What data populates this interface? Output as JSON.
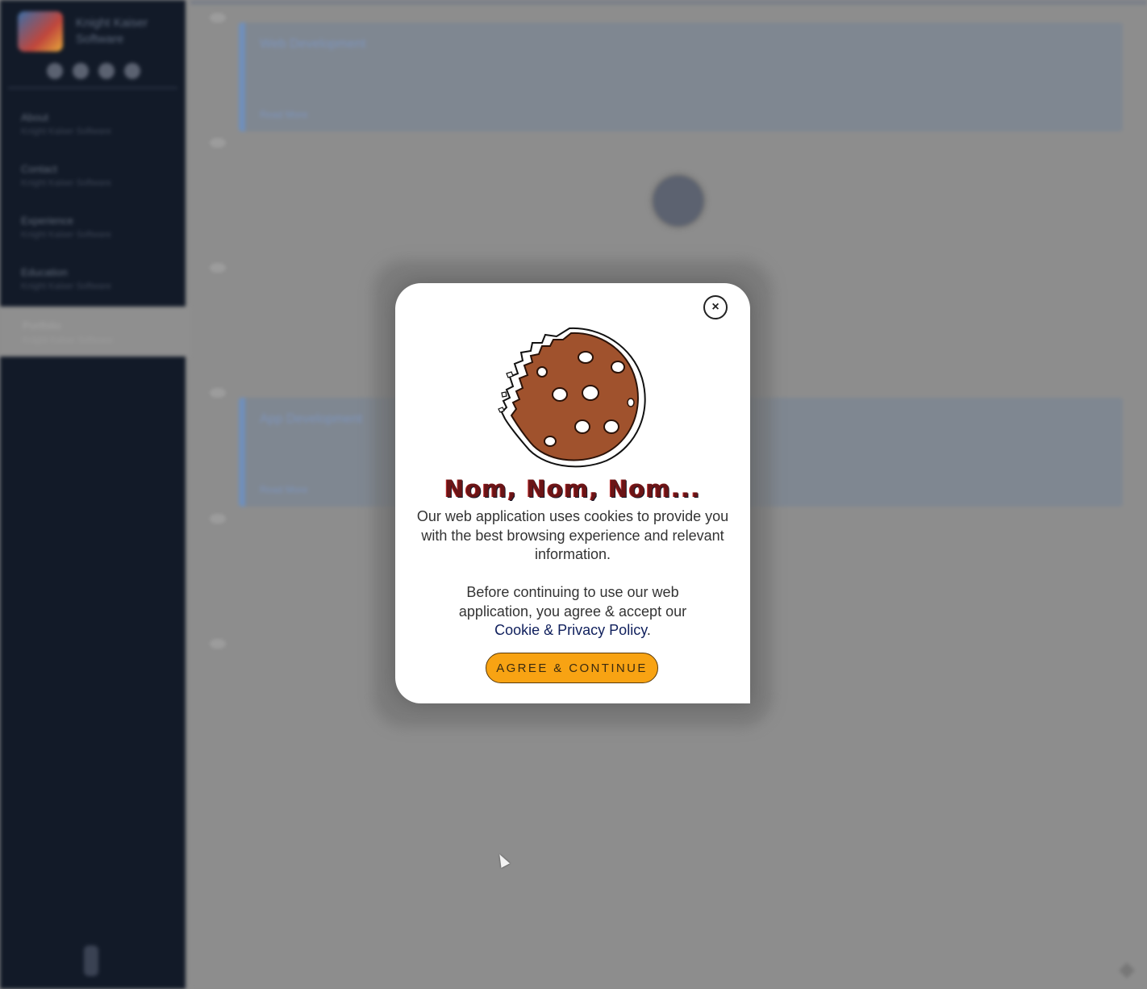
{
  "app": {
    "brand_name": "Knight Kaiser Software",
    "social_icons": [
      "social-icon-1",
      "social-icon-2",
      "social-icon-3",
      "social-icon-4"
    ],
    "nav_items": [
      {
        "title": "About",
        "subtitle": "Knight Kaiser Software"
      },
      {
        "title": "Contact",
        "subtitle": "Knight Kaiser Software"
      },
      {
        "title": "Experience",
        "subtitle": "Knight Kaiser Software"
      },
      {
        "title": "Education",
        "subtitle": "Knight Kaiser Software"
      }
    ],
    "active_item": {
      "title": "Portfolio",
      "subtitle": "Knight Kaiser Software"
    },
    "cards": [
      {
        "title": "Web Development",
        "footer": "Read More"
      },
      {
        "title": "App Development",
        "footer": "Read More"
      }
    ]
  },
  "cookie_modal": {
    "close_label": "×",
    "title": "Nom, Nom, Nom...",
    "paragraph_1": "Our web application uses cookies to provide you with the best browsing experience and relevant information.",
    "paragraph_2_prefix": "Before continuing to use our web application, you agree & accept our",
    "policy_link": "Cookie & Privacy Policy",
    "paragraph_2_suffix": ".",
    "agree_button": "AGREE & CONTINUE"
  },
  "colors": {
    "sidebar_bg": "#121a28",
    "overlay_bg": "#8d8d8d",
    "accent_button": "#f8a313",
    "title_color": "#6b1416",
    "link_color": "#0f1f5c",
    "cookie_fill": "#a0522d"
  }
}
